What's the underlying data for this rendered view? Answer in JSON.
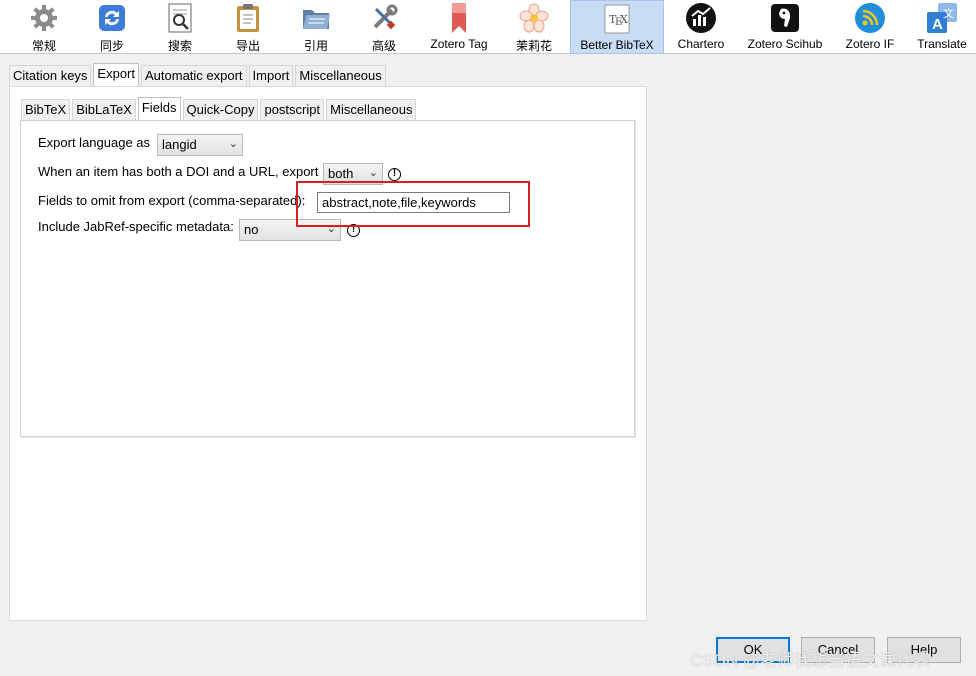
{
  "toolbar": {
    "items": [
      {
        "label": "常规",
        "icon": "gear-icon"
      },
      {
        "label": "同步",
        "icon": "sync-icon"
      },
      {
        "label": "搜索",
        "icon": "search-doc-icon"
      },
      {
        "label": "导出",
        "icon": "clipboard-icon"
      },
      {
        "label": "引用",
        "icon": "folder-icon"
      },
      {
        "label": "高级",
        "icon": "tools-icon"
      },
      {
        "label": "Zotero Tag",
        "icon": "bookmark-icon"
      },
      {
        "label": "茉莉花",
        "icon": "flower-icon"
      },
      {
        "label": "Better BibTeX",
        "icon": "tex-icon"
      },
      {
        "label": "Chartero",
        "icon": "chart-icon"
      },
      {
        "label": "Zotero Scihub",
        "icon": "bird-icon"
      },
      {
        "label": "Zotero IF",
        "icon": "rss-icon"
      },
      {
        "label": "Translate",
        "icon": "translate-icon"
      }
    ],
    "selected_index": 8
  },
  "outer_tabs": [
    "Citation keys",
    "Export",
    "Automatic export",
    "Import",
    "Miscellaneous"
  ],
  "inner_tabs": [
    "BibTeX",
    "BibLaTeX",
    "Fields",
    "Quick-Copy",
    "postscript",
    "Miscellaneous"
  ],
  "fields": {
    "export_language_label": "Export language as",
    "export_language_value": "langid",
    "doi_url_label": "When an item has both a DOI and a URL, export",
    "doi_url_value": "both",
    "omit_label": "Fields to omit from export (comma-separated):",
    "omit_value": "abstract,note,file,keywords",
    "jabref_label": "Include JabRef-specific metadata:",
    "jabref_value": "no"
  },
  "buttons": {
    "ok": "OK",
    "cancel": "Cancel",
    "help": "Help"
  },
  "watermark": "CSDN @老师我想当语文课代表",
  "colors": {
    "selected_tab_bg": "#c8dcf5",
    "highlight_border": "#d81e1e",
    "primary_border": "#0078d7"
  }
}
